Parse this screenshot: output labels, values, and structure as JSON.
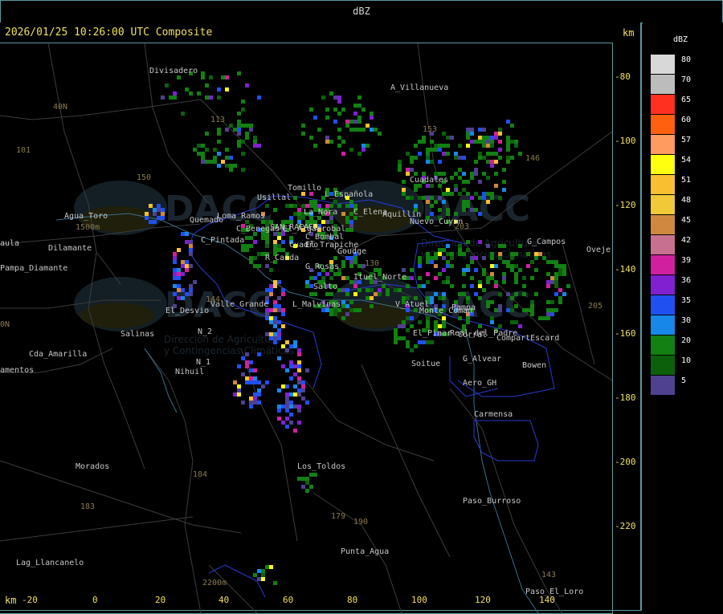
{
  "title": "dBZ",
  "header": "2026/01/25 10:26:00 UTC Composite",
  "km_label": "km",
  "x_ticks": [
    "-20",
    "0",
    "20",
    "40",
    "60",
    "80",
    "100",
    "120",
    "140"
  ],
  "y_ticks": [
    "-80",
    "-100",
    "-120",
    "-140",
    "-160",
    "-180",
    "-200",
    "-220"
  ],
  "legend": {
    "title": "dBZ",
    "entries": [
      {
        "value": "80",
        "color": "#d8d8d8"
      },
      {
        "value": "70",
        "color": "#bcbcbc"
      },
      {
        "value": "65",
        "color": "#ff3020"
      },
      {
        "value": "60",
        "color": "#ff6010"
      },
      {
        "value": "57",
        "color": "#ff9a60"
      },
      {
        "value": "54",
        "color": "#ffff10"
      },
      {
        "value": "51",
        "color": "#f8c030"
      },
      {
        "value": "48",
        "color": "#f0c838"
      },
      {
        "value": "45",
        "color": "#d08840"
      },
      {
        "value": "42",
        "color": "#c87090"
      },
      {
        "value": "39",
        "color": "#d020a0"
      },
      {
        "value": "36",
        "color": "#8020d0"
      },
      {
        "value": "35",
        "color": "#2050f0"
      },
      {
        "value": "30",
        "color": "#1888e8"
      },
      {
        "value": "20",
        "color": "#128012"
      },
      {
        "value": "10",
        "color": "#0c600c"
      },
      {
        "value": "5",
        "color": "#504090"
      }
    ]
  },
  "places": [
    "Divisadero",
    "A_Villanueva",
    "40N",
    "101",
    "150",
    "Usillal",
    "Tomillo",
    "L_Española",
    "Cuadales",
    "La_Nora",
    "C_Elena",
    "Aquillin",
    "Nuevo_Cuyan",
    "Agua_Toro",
    "1500m",
    "Dilamante",
    "aula",
    "Pampa_Diamante",
    "Quemado",
    "Loma_Ramos",
    "C_Benegas",
    "SAN_RAFAEL",
    "El_Algarrobal",
    "C_Bombal",
    "C_Pintada",
    "El_Trapiche",
    "Cuadro",
    "Goudge",
    "R_Caida",
    "G_Rosas",
    "Ituel_Norte",
    "G_Campos",
    "Oveje",
    "Salto",
    "Salinas",
    "El_Desvio",
    "Valle_Grande",
    "L_Malvinas",
    "V_Atuel",
    "Pampa",
    "Monte_Coman",
    "El_Pinar",
    "Real_del_Padre",
    "Corral",
    "CompartEscard",
    "Cda_Amarilla",
    "N_2",
    "N_1",
    "Nihuil",
    "amentos",
    "Soitue",
    "G_Alvear",
    "Bowen",
    "Aero_GH",
    "Carmensa",
    "Morados",
    "Los_Toldos",
    "Paso_Burroso",
    "184",
    "183",
    "179",
    "190",
    "Lag_Llancanelo",
    "Punta_Agua",
    "2200m",
    "Paso_El_Loro",
    "143",
    "146",
    "153",
    "203",
    "205",
    "144",
    "113",
    "130",
    "0N"
  ],
  "watermark": {
    "org": "DACC",
    "line1": "Dirección de Agricultura",
    "line2": "y Contingencias Climáticas"
  }
}
